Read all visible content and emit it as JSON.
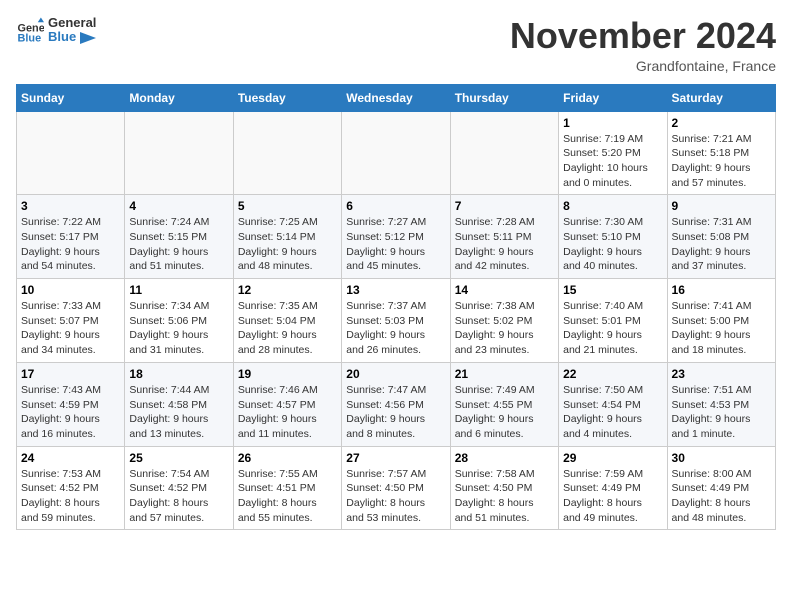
{
  "header": {
    "logo_general": "General",
    "logo_blue": "Blue",
    "month_title": "November 2024",
    "subtitle": "Grandfontaine, France"
  },
  "calendar": {
    "days_of_week": [
      "Sunday",
      "Monday",
      "Tuesday",
      "Wednesday",
      "Thursday",
      "Friday",
      "Saturday"
    ],
    "weeks": [
      [
        {
          "day": "",
          "info": ""
        },
        {
          "day": "",
          "info": ""
        },
        {
          "day": "",
          "info": ""
        },
        {
          "day": "",
          "info": ""
        },
        {
          "day": "",
          "info": ""
        },
        {
          "day": "1",
          "info": "Sunrise: 7:19 AM\nSunset: 5:20 PM\nDaylight: 10 hours\nand 0 minutes."
        },
        {
          "day": "2",
          "info": "Sunrise: 7:21 AM\nSunset: 5:18 PM\nDaylight: 9 hours\nand 57 minutes."
        }
      ],
      [
        {
          "day": "3",
          "info": "Sunrise: 7:22 AM\nSunset: 5:17 PM\nDaylight: 9 hours\nand 54 minutes."
        },
        {
          "day": "4",
          "info": "Sunrise: 7:24 AM\nSunset: 5:15 PM\nDaylight: 9 hours\nand 51 minutes."
        },
        {
          "day": "5",
          "info": "Sunrise: 7:25 AM\nSunset: 5:14 PM\nDaylight: 9 hours\nand 48 minutes."
        },
        {
          "day": "6",
          "info": "Sunrise: 7:27 AM\nSunset: 5:12 PM\nDaylight: 9 hours\nand 45 minutes."
        },
        {
          "day": "7",
          "info": "Sunrise: 7:28 AM\nSunset: 5:11 PM\nDaylight: 9 hours\nand 42 minutes."
        },
        {
          "day": "8",
          "info": "Sunrise: 7:30 AM\nSunset: 5:10 PM\nDaylight: 9 hours\nand 40 minutes."
        },
        {
          "day": "9",
          "info": "Sunrise: 7:31 AM\nSunset: 5:08 PM\nDaylight: 9 hours\nand 37 minutes."
        }
      ],
      [
        {
          "day": "10",
          "info": "Sunrise: 7:33 AM\nSunset: 5:07 PM\nDaylight: 9 hours\nand 34 minutes."
        },
        {
          "day": "11",
          "info": "Sunrise: 7:34 AM\nSunset: 5:06 PM\nDaylight: 9 hours\nand 31 minutes."
        },
        {
          "day": "12",
          "info": "Sunrise: 7:35 AM\nSunset: 5:04 PM\nDaylight: 9 hours\nand 28 minutes."
        },
        {
          "day": "13",
          "info": "Sunrise: 7:37 AM\nSunset: 5:03 PM\nDaylight: 9 hours\nand 26 minutes."
        },
        {
          "day": "14",
          "info": "Sunrise: 7:38 AM\nSunset: 5:02 PM\nDaylight: 9 hours\nand 23 minutes."
        },
        {
          "day": "15",
          "info": "Sunrise: 7:40 AM\nSunset: 5:01 PM\nDaylight: 9 hours\nand 21 minutes."
        },
        {
          "day": "16",
          "info": "Sunrise: 7:41 AM\nSunset: 5:00 PM\nDaylight: 9 hours\nand 18 minutes."
        }
      ],
      [
        {
          "day": "17",
          "info": "Sunrise: 7:43 AM\nSunset: 4:59 PM\nDaylight: 9 hours\nand 16 minutes."
        },
        {
          "day": "18",
          "info": "Sunrise: 7:44 AM\nSunset: 4:58 PM\nDaylight: 9 hours\nand 13 minutes."
        },
        {
          "day": "19",
          "info": "Sunrise: 7:46 AM\nSunset: 4:57 PM\nDaylight: 9 hours\nand 11 minutes."
        },
        {
          "day": "20",
          "info": "Sunrise: 7:47 AM\nSunset: 4:56 PM\nDaylight: 9 hours\nand 8 minutes."
        },
        {
          "day": "21",
          "info": "Sunrise: 7:49 AM\nSunset: 4:55 PM\nDaylight: 9 hours\nand 6 minutes."
        },
        {
          "day": "22",
          "info": "Sunrise: 7:50 AM\nSunset: 4:54 PM\nDaylight: 9 hours\nand 4 minutes."
        },
        {
          "day": "23",
          "info": "Sunrise: 7:51 AM\nSunset: 4:53 PM\nDaylight: 9 hours\nand 1 minute."
        }
      ],
      [
        {
          "day": "24",
          "info": "Sunrise: 7:53 AM\nSunset: 4:52 PM\nDaylight: 8 hours\nand 59 minutes."
        },
        {
          "day": "25",
          "info": "Sunrise: 7:54 AM\nSunset: 4:52 PM\nDaylight: 8 hours\nand 57 minutes."
        },
        {
          "day": "26",
          "info": "Sunrise: 7:55 AM\nSunset: 4:51 PM\nDaylight: 8 hours\nand 55 minutes."
        },
        {
          "day": "27",
          "info": "Sunrise: 7:57 AM\nSunset: 4:50 PM\nDaylight: 8 hours\nand 53 minutes."
        },
        {
          "day": "28",
          "info": "Sunrise: 7:58 AM\nSunset: 4:50 PM\nDaylight: 8 hours\nand 51 minutes."
        },
        {
          "day": "29",
          "info": "Sunrise: 7:59 AM\nSunset: 4:49 PM\nDaylight: 8 hours\nand 49 minutes."
        },
        {
          "day": "30",
          "info": "Sunrise: 8:00 AM\nSunset: 4:49 PM\nDaylight: 8 hours\nand 48 minutes."
        }
      ]
    ]
  }
}
